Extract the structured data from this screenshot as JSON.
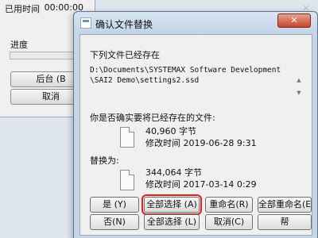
{
  "background_window": {
    "elapsed_label": "已用时间",
    "elapsed_value": "00:00:00",
    "progress_label": "进度",
    "progress": 0,
    "background_button": "后台 (B",
    "cancel_button": "取消"
  },
  "dialog": {
    "title": "确认文件替换",
    "close_label": "✕",
    "exists_heading": "下列文件已经存在",
    "path_lines": [
      "D:\\Documents\\SYSTEMAX Software Development",
      "\\SAI2 Demo\\settings2.ssd"
    ],
    "replace_question": "你是否确实要将已经存在的文件:",
    "existing_file": {
      "size": "40,960 字节",
      "modified": "修改时间 2019-06-28 9:31"
    },
    "replace_with_label": "替换为:",
    "new_file": {
      "size": "344,064 字节",
      "modified": "修改时间 2017-03-14 0:29"
    },
    "buttons_row1": [
      "是 (Y)",
      "全部选择 (A)",
      "重命名(R)",
      "全部重命名(E)"
    ],
    "buttons_row2": [
      "否(N)",
      "全部选择 (L)",
      "取消(C)",
      "帮"
    ]
  }
}
